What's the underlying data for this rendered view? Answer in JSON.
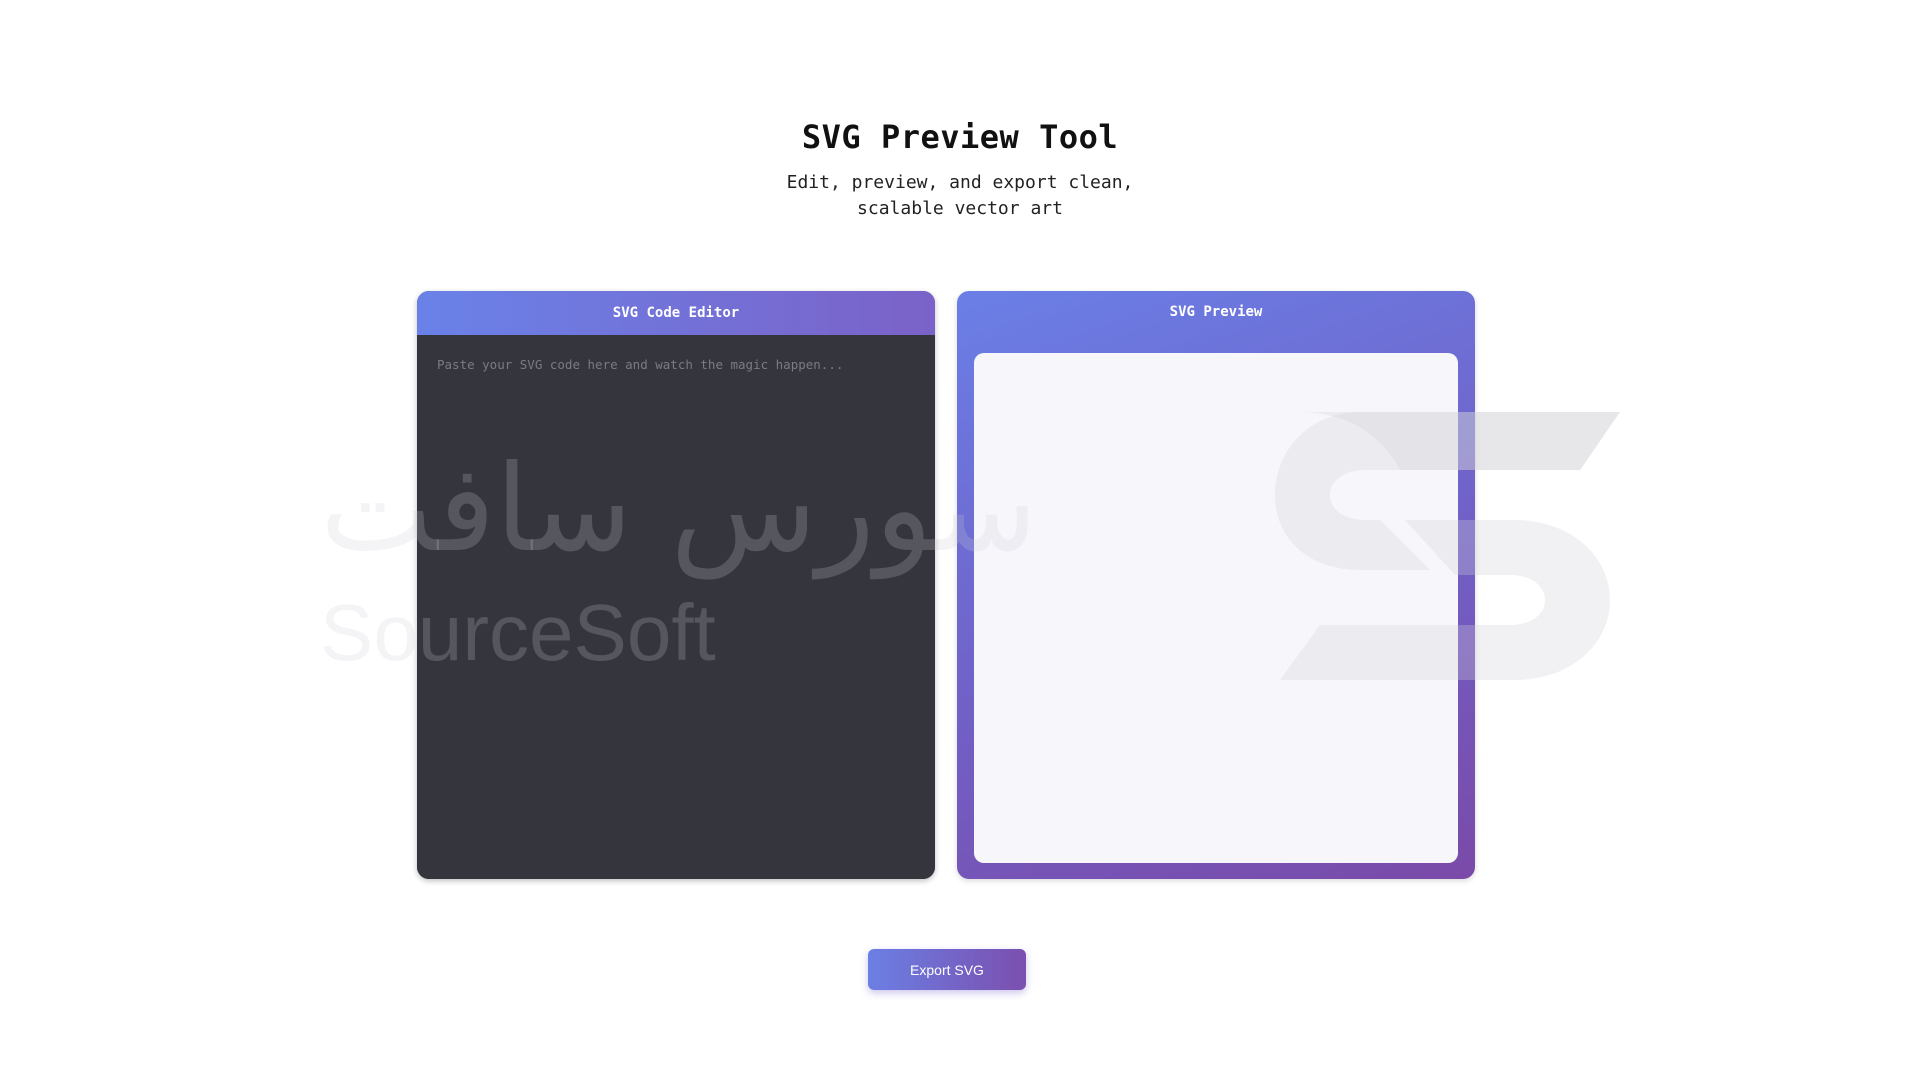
{
  "header": {
    "title": "SVG Preview Tool",
    "subtitle": "Edit, preview, and export clean, scalable vector art"
  },
  "editor": {
    "title": "SVG Code Editor",
    "placeholder": "Paste your SVG code here and watch the magic happen...",
    "value": ""
  },
  "preview": {
    "title": "SVG Preview"
  },
  "actions": {
    "export_label": "Export SVG"
  },
  "watermark": {
    "text_latin": "SourceSoft",
    "text_arabic": "سورس سافت",
    "icon": "s-logo-icon"
  },
  "colors": {
    "accent_start": "#6a82e8",
    "accent_end": "#7b4fae",
    "editor_bg": "#34353d",
    "preview_bg": "#f7f7fb"
  }
}
